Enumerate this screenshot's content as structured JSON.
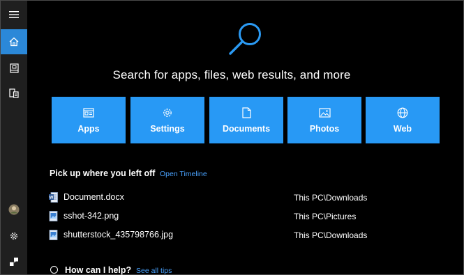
{
  "hero": {
    "text": "Search for apps, files, web results, and more"
  },
  "tiles": [
    {
      "label": "Apps",
      "icon": "apps-icon"
    },
    {
      "label": "Settings",
      "icon": "settings-icon"
    },
    {
      "label": "Documents",
      "icon": "document-icon"
    },
    {
      "label": "Photos",
      "icon": "photo-icon"
    },
    {
      "label": "Web",
      "icon": "globe-icon"
    }
  ],
  "recent": {
    "header": "Pick up where you left off",
    "link": "Open Timeline",
    "items": [
      {
        "name": "Document.docx",
        "path": "This PC\\Downloads",
        "icon": "word-document-icon"
      },
      {
        "name": "sshot-342.png",
        "path": "This PC\\Pictures",
        "icon": "image-file-icon"
      },
      {
        "name": "shutterstock_435798766.jpg",
        "path": "This PC\\Downloads",
        "icon": "image-file-icon"
      }
    ]
  },
  "help": {
    "text": "How can I help?",
    "link": "See all tips"
  },
  "sidebar": {
    "items": [
      "hamburger-menu-icon",
      "home-icon",
      "notebook-icon",
      "devices-icon",
      "avatar",
      "gear-icon",
      "feedback-icon"
    ]
  },
  "colors": {
    "accent": "#2899f5",
    "active": "#2b88d8",
    "link": "#4aa3ff",
    "background": "#000000",
    "sidebar": "#1f1f1f"
  }
}
